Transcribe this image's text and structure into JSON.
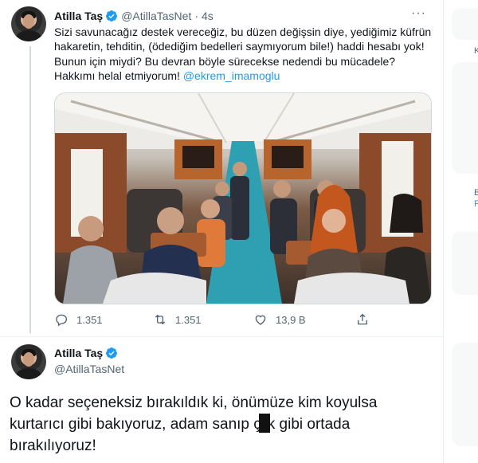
{
  "tweet1": {
    "author_name": "Atilla Taş",
    "handle": "@AtillaTasNet",
    "separator": "·",
    "time": "4s",
    "more_label": "···",
    "text_lines": [
      "Sizi savunacağız destek vereceğiz, bu düzen değişsin diye, yediğimiz küfrün",
      "hakaretin, tehditin, (ödediğim bedelleri saymıyorum bile!) haddi hesabı yok!",
      "Bunun için miydi? Bu devran böyle sürecekse nedendi bu mücadele?",
      "Hakkımı helal etmiyorum! "
    ],
    "mention": "@ekrem_imamoglu",
    "reply_count": "1.351",
    "retweet_count": "1.351",
    "like_count": "13,9 B"
  },
  "tweet2": {
    "author_name": "Atilla Taş",
    "handle": "@AtillaTasNet",
    "text_line1": "O kadar seçeneksiz bırakıldık ki, önümüze kim koyulsa",
    "text_line2_a": "kurtarıcı gibi bakıyoruz, adam sanıp ç",
    "text_line2_b": "k gibi ortada",
    "text_line3": "bırakılıyoruz!"
  },
  "sidebar": {
    "frag1": "K",
    "frag2": "B",
    "frag3": "F"
  },
  "colors": {
    "accent": "#1d9bf0",
    "text": "#0f1419",
    "secondary": "#536471"
  }
}
